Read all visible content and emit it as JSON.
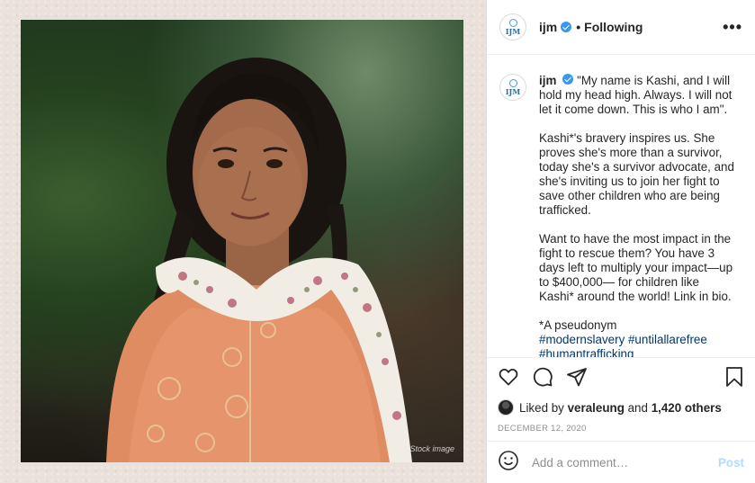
{
  "photo": {
    "label": "Stock image"
  },
  "header": {
    "username": "ijm",
    "separator": "•",
    "follow_status": "Following",
    "more": "•••",
    "avatar_text": "IJM"
  },
  "caption": {
    "username": "ijm",
    "paragraphs": [
      "\"My name is Kashi, and I will hold my head high. Always. I will not let it come down. This is who I am\".",
      "Kashi*'s bravery inspires us. She proves she's more than a survivor, today she's a survivor advocate, and she's inviting us to join her fight to save other children who are being trafficked.",
      "Want to have the most impact in the fight to rescue them? You have 3 days left to multiply your impact—up to $400,000— for children like Kashi* around the world! Link in bio."
    ],
    "footnote": "*A pseudonym",
    "hashtags_line1": "#modernslavery #untilallarefree",
    "hashtags_line2": "#humantrafficking"
  },
  "likes": {
    "prefix": "Liked by",
    "user": "veraleung",
    "joiner": "and",
    "others": "1,420 others"
  },
  "date": "DECEMBER 12, 2020",
  "comment": {
    "placeholder": "Add a comment…",
    "post_label": "Post"
  },
  "icons": {
    "like": "heart-icon",
    "comment": "comment-icon",
    "share": "share-icon",
    "save": "bookmark-icon",
    "emoji": "emoji-icon"
  },
  "colors": {
    "verified": "#3897f0",
    "hashtag": "#00376b",
    "post_disabled": "#b3dbff",
    "muted": "#8e8e8e"
  }
}
